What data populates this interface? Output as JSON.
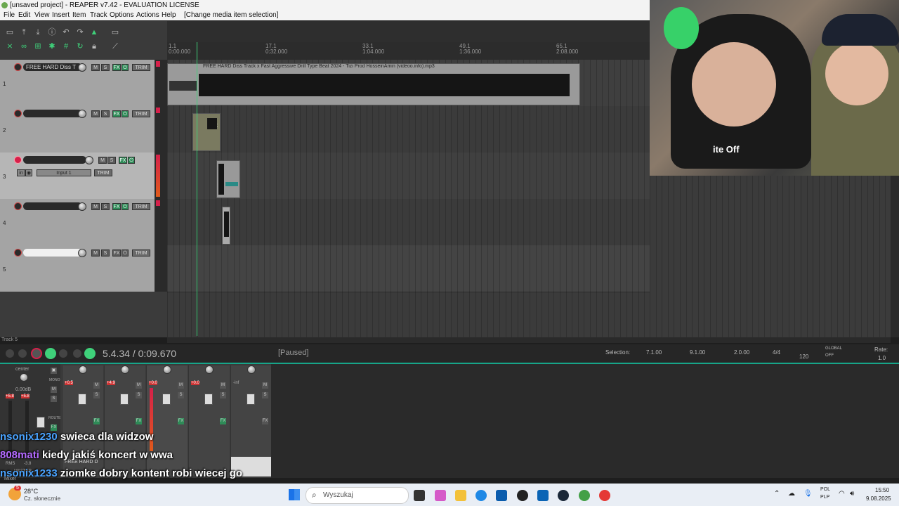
{
  "window": {
    "title": "[unsaved project] - REAPER v7.42 - EVALUATION LICENSE"
  },
  "menu": [
    "File",
    "Edit",
    "View",
    "Insert",
    "Item",
    "Track",
    "Options",
    "Actions",
    "Help",
    "[Change media item selection]"
  ],
  "ruler": {
    "marks": [
      {
        "bar": "1.1",
        "time": "0:00.000"
      },
      {
        "bar": "17.1",
        "time": "0:32.000"
      },
      {
        "bar": "33.1",
        "time": "1:04.000"
      },
      {
        "bar": "49.1",
        "time": "1:36.000"
      },
      {
        "bar": "65.1",
        "time": "2:08.000"
      }
    ]
  },
  "tracks": [
    {
      "num": "1",
      "name": "FREE HARD Diss T"
    },
    {
      "num": "2",
      "name": ""
    },
    {
      "num": "3",
      "name": "",
      "input": "Input 1",
      "in_label": "in"
    },
    {
      "num": "4",
      "name": ""
    },
    {
      "num": "5",
      "name": ""
    }
  ],
  "tcp_buttons": {
    "mute": "M",
    "solo": "S",
    "fx": "FX",
    "trim": "TRIM"
  },
  "item": {
    "label": "FREE HARD Diss Track x Fast Aggressive Drill Type Beat 2024 - Tizi Prod HosseinAmin (videoo.info).mp3",
    "tag": "FX"
  },
  "track_label_bottom": "Track 5",
  "transport": {
    "position": "5.4.34 / 0:09.670",
    "status": "[Paused]",
    "selection_label": "Selection:",
    "selection_start": "7.1.00",
    "selection_end": "9.1.00",
    "selection_len": "2.0.00",
    "time_sig": "4/4",
    "bpm": "120",
    "global_label": "GLOBAL",
    "global_state": "OFF",
    "rate_label": "Rate:",
    "rate_value": "1.0"
  },
  "mixer": {
    "master": {
      "pan_label": "center",
      "volume": "0.00dB",
      "peak_l": "+5.8",
      "peak_r": "+5.8",
      "rms_label": "RMS",
      "rms_value": "-3.8",
      "name": "MASTER",
      "mono": "MONO",
      "route": "ROUTE"
    },
    "peaks": [
      "+0.5",
      "+4.9",
      "+0.0",
      "+0.0",
      "-inf"
    ],
    "strip_name": "FREE HARD D",
    "tab_label": "Mixer"
  },
  "chat": [
    {
      "user": "nsonix1230",
      "message": "swieca dla widzow"
    },
    {
      "user": "808mati",
      "message": "kiedy jakiś koncert w wwa"
    },
    {
      "user": "nsonix1233",
      "message": "ziomke dobry kontent robi wiecej go"
    }
  ],
  "taskbar": {
    "weather_temp": "28°C",
    "weather_desc": "Cz. słonecznie",
    "weather_badge": "5",
    "search_placeholder": "Wyszukaj",
    "lang_top": "POL",
    "lang_bottom": "PLP",
    "time": "15:50",
    "date": "9.08.2025"
  },
  "webcam": {
    "shirt_text": "ite Off"
  },
  "colors": {
    "accent": "#17a589",
    "fx_green": "#2e8b57",
    "rec_red": "#d6204a",
    "play_green": "#3fd17a"
  }
}
